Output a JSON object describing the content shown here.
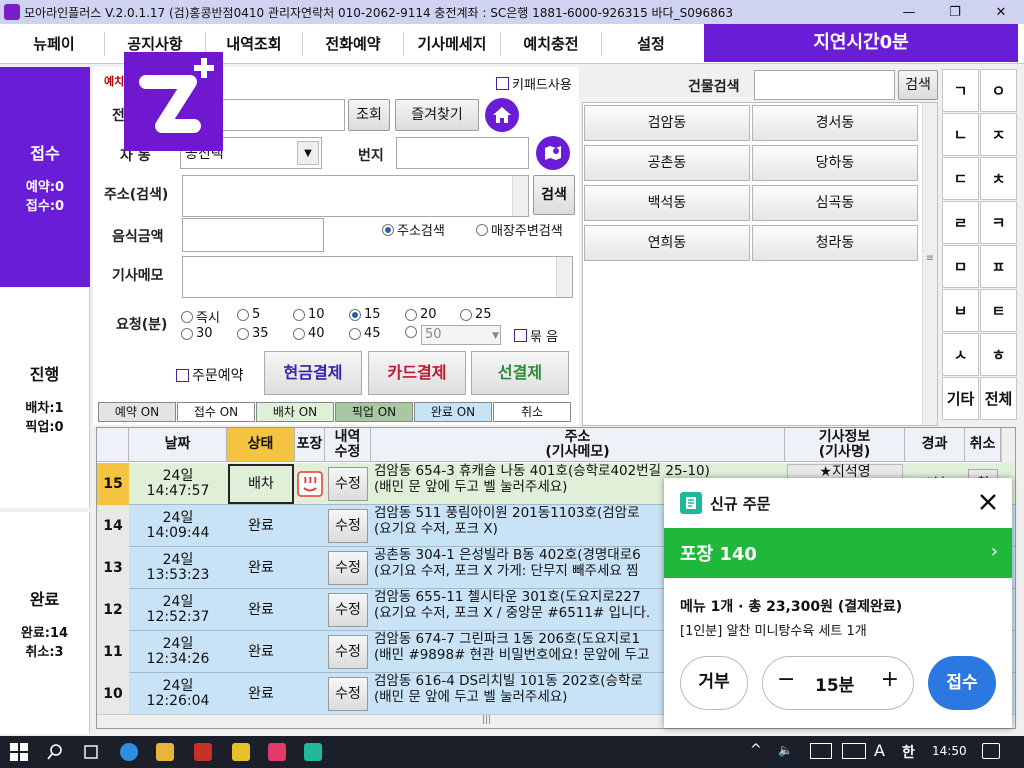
{
  "titlebar": {
    "title": "모아라인플러스 V.2.0.1.17  (검)홍콩반점0410   관리자연락처  010-2062-9114   충전계좌 : SC은행  1881-6000-926315   바다_S096863",
    "minimize": "—",
    "restore": "❐",
    "close": "✕"
  },
  "menu": {
    "items": [
      "뉴페이",
      "공지사항",
      "내역조회",
      "전화예약",
      "기사메세지",
      "예치충전",
      "설정"
    ],
    "delay_label": "지연시간0분"
  },
  "left_panels": {
    "receipt": {
      "title": "접수",
      "line1": "예약:0",
      "line2": "접수:0"
    },
    "progress": {
      "title": "진행",
      "line1": "배차:1",
      "line2": "픽업:0"
    },
    "done": {
      "title": "완료",
      "line1": "완료:14",
      "line2": "취소:3"
    }
  },
  "form": {
    "section_label": "예치",
    "phone_label": "전",
    "lookup_btn": "조회",
    "favorites_btn": "즐겨찾기",
    "keypad_use": "키패드사용",
    "area_label": "자 동",
    "area_value": "공진택",
    "bunji_label": "번지",
    "address_label": "주소(검색)",
    "address_search_btn": "검색",
    "food_amount_label": "음식금액",
    "radio_address": "주소검색",
    "radio_store": "매장주변검색",
    "driver_memo_label": "기사메모",
    "request_label": "요청(분)",
    "request_options": [
      "즉시",
      "5",
      "10",
      "15",
      "20",
      "25",
      "30",
      "35",
      "40",
      "45"
    ],
    "request_selected": "15",
    "request_custom": "50",
    "bundle_label": "묶 음",
    "preorder_label": "주문예약",
    "cash_btn": "현금결제",
    "card_btn": "카드결제",
    "prepaid_btn": "선결제",
    "status_flags": [
      "예약 ON",
      "접수 ON",
      "배차 ON",
      "픽업 ON",
      "완료 ON",
      "취소"
    ]
  },
  "building_search": {
    "label": "건물검색",
    "button": "검색",
    "dongs": [
      "검암동",
      "경서동",
      "공촌동",
      "당하동",
      "백석동",
      "심곡동",
      "연희동",
      "청라동"
    ]
  },
  "keypad": {
    "left": [
      "ㄱ",
      "ㄴ",
      "ㄷ",
      "ㄹ",
      "ㅁ",
      "ㅂ",
      "ㅅ",
      "기타"
    ],
    "right": [
      "ㅇ",
      "ㅈ",
      "ㅊ",
      "ㅋ",
      "ㅍ",
      "ㅌ",
      "ㅎ",
      "전체"
    ]
  },
  "table": {
    "headers": {
      "date": "날짜",
      "status": "상태",
      "pack": "포장",
      "edit_line1": "내역",
      "edit_line2": "수정",
      "addr_line1": "주소",
      "addr_line2": "(기사메모)",
      "driver_line1": "기사정보",
      "driver_line2": "(기사명)",
      "elapsed": "경과",
      "cancel": "취소"
    },
    "rows": [
      {
        "no": "15",
        "date": "24일",
        "time": "14:47:57",
        "status": "배차",
        "edit": "수정",
        "addr": "검암동 654-3 휴캐슬 나동 401호(승학로402번길 25-10)",
        "memo": "(배민 문 앞에 두고 벨 눌러주세요)",
        "driver": "★지석영",
        "elapsed": "0분",
        "cancel": "취"
      },
      {
        "no": "14",
        "date": "24일",
        "time": "14:09:44",
        "status": "완료",
        "edit": "수정",
        "addr": "검암동 511 풍림아이원 201동1103호(검암로",
        "memo": "(요기요 수저, 포크 X)"
      },
      {
        "no": "13",
        "date": "24일",
        "time": "13:53:23",
        "status": "완료",
        "edit": "수정",
        "addr": "공촌동 304-1 은성빌라 B동 402호(경명대로6",
        "memo": "(요기요 수저, 포크 X  가게: 단무지 빼주세요 찜"
      },
      {
        "no": "12",
        "date": "24일",
        "time": "12:52:37",
        "status": "완료",
        "edit": "수정",
        "addr": "검암동 655-11 첼시타운 301호(도요지로227",
        "memo": "(요기요 수저, 포크 X / 중앙문 #6511# 입니다."
      },
      {
        "no": "11",
        "date": "24일",
        "time": "12:34:26",
        "status": "완료",
        "edit": "수정",
        "addr": "검암동 674-7 그린파크 1동 206호(도요지로1",
        "memo": "(배민 #9898# 현관 비밀번호에요! 문앞에 두고"
      },
      {
        "no": "10",
        "date": "24일",
        "time": "12:26:04",
        "status": "완료",
        "edit": "수정",
        "addr": "검암동 616-4 DS리치빌 101동 202호(승학로",
        "memo": "(배민 문 앞에 두고 벨 눌러주세요)"
      }
    ]
  },
  "popup": {
    "title": "신규 주문",
    "order_label": "포장 140",
    "summary": "메뉴 1개 · 총 23,300원 (결제완료)",
    "item": "[1인분] 알찬 미니탕수육 세트 1개",
    "reject_btn": "거부",
    "minus": "−",
    "time_value": "15분",
    "plus": "+",
    "accept_btn": "접수"
  },
  "taskbar": {
    "lang": "A",
    "ime": "한",
    "clock": "14:50"
  },
  "colors": {
    "accent_purple": "#6a1dd6",
    "popup_green": "#1fb83a",
    "accept_blue": "#2a78e0"
  }
}
